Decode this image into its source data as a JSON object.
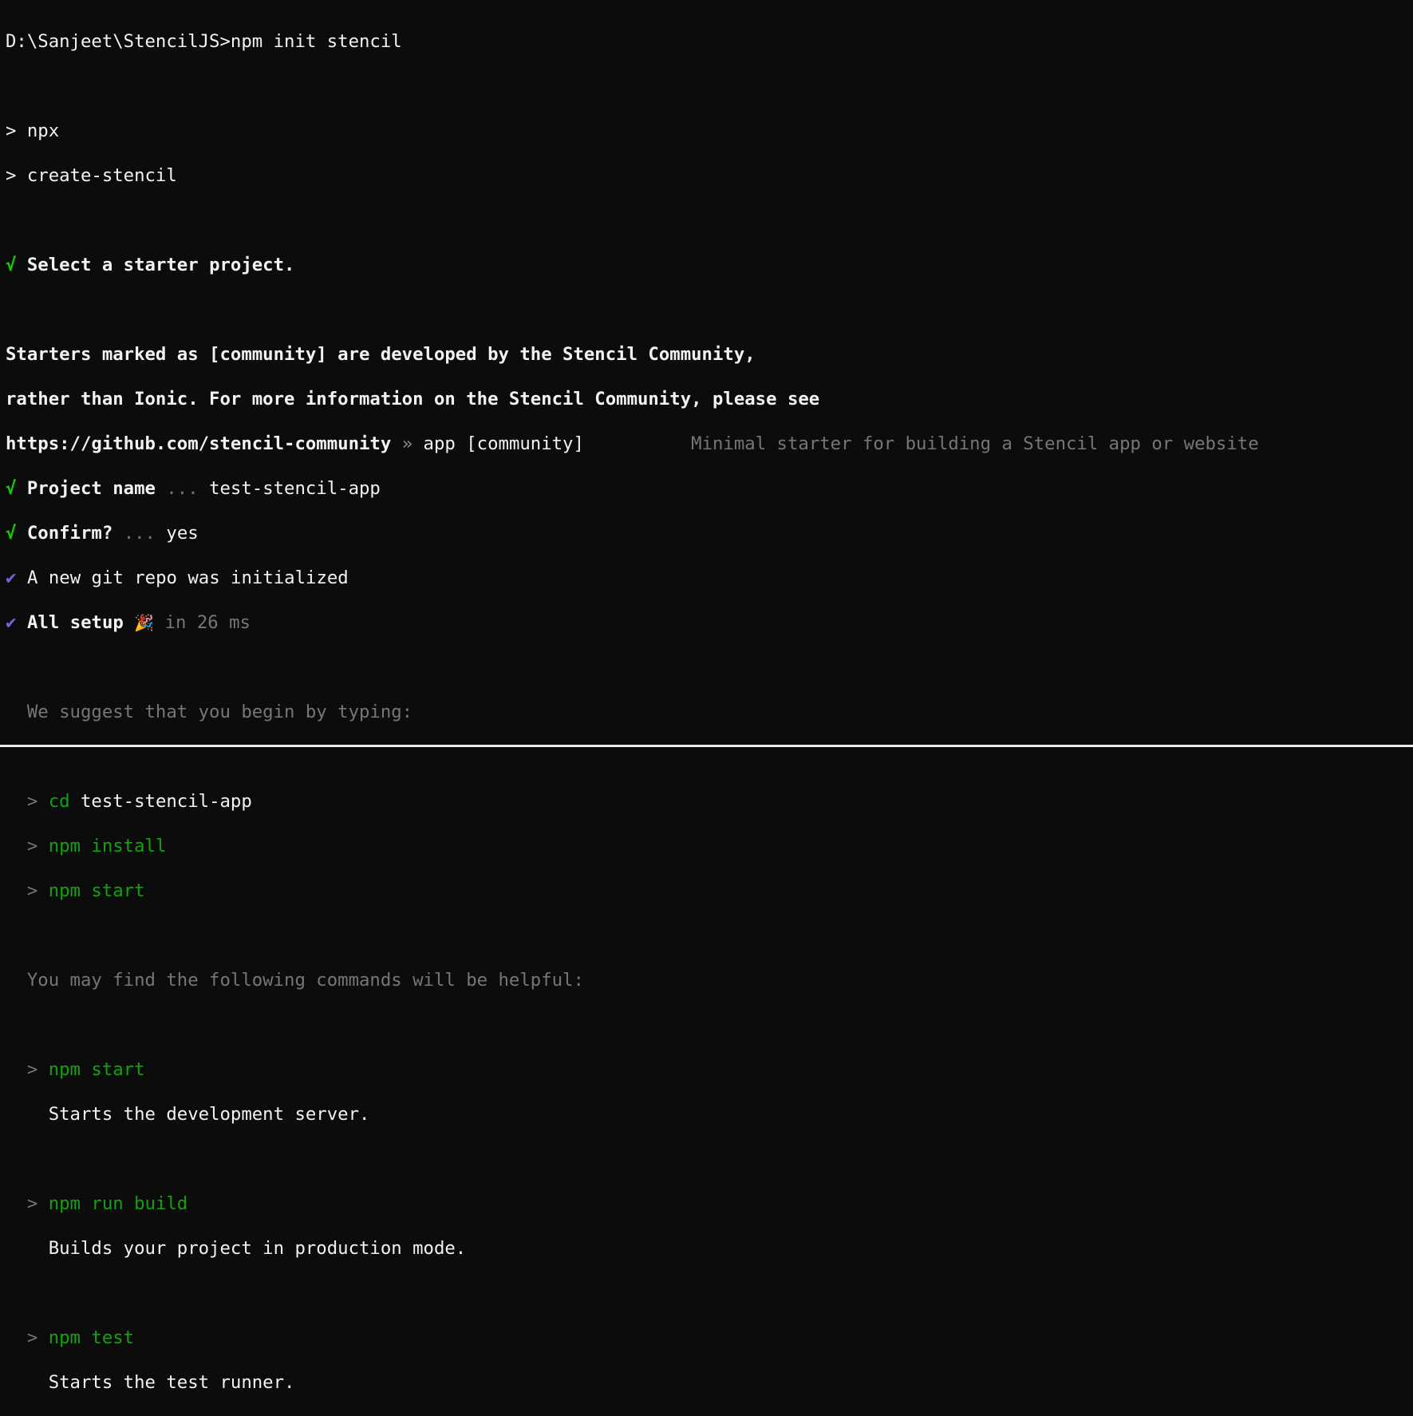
{
  "prompt": {
    "path": "D:\\Sanjeet\\StencilJS>",
    "command": "npm init stencil"
  },
  "npx": {
    "l1": "> npx",
    "l2": "> create-stencil"
  },
  "select": {
    "check": "√",
    "text": " Select a starter project."
  },
  "info": {
    "l1": "Starters marked as [community] are developed by the Stencil Community,",
    "l2": "rather than Ionic. For more information on the Stencil Community, please see",
    "l3a": "https://github.com/stencil-community",
    "l3sep": " » ",
    "l3b": "app [community]",
    "l3gap": "          ",
    "l3desc": "Minimal starter for building a Stencil app or website"
  },
  "project": {
    "check": "√",
    "label": " Project name",
    "dots": " ... ",
    "value": "test-stencil-app"
  },
  "confirm": {
    "check": "√",
    "label": " Confirm?",
    "dots": " ... ",
    "value": "yes"
  },
  "git": {
    "check": "✔",
    "text": "A new git repo was initialized"
  },
  "setup": {
    "check": "✔",
    "text": "All setup ",
    "emoji": "🎉",
    "time": " in 26 ms"
  },
  "suggest": {
    "heading": "  We suggest that you begin by typing:",
    "cmd1_arrow": "  > ",
    "cmd1_cmd": "cd",
    "cmd1_arg": " test-stencil-app",
    "cmd2_arrow": "  > ",
    "cmd2_cmd": "npm install",
    "cmd3_arrow": "  > ",
    "cmd3_cmd": "npm start"
  },
  "helpful": {
    "heading": "  You may find the following commands will be helpful:",
    "items": [
      {
        "arrow": "  > ",
        "cmd": "npm start",
        "desc": "    Starts the development server."
      },
      {
        "arrow": "  > ",
        "cmd": "npm run build",
        "desc": "    Builds your project in production mode."
      },
      {
        "arrow": "  > ",
        "cmd": "npm test",
        "desc": "    Starts the test runner."
      }
    ]
  }
}
